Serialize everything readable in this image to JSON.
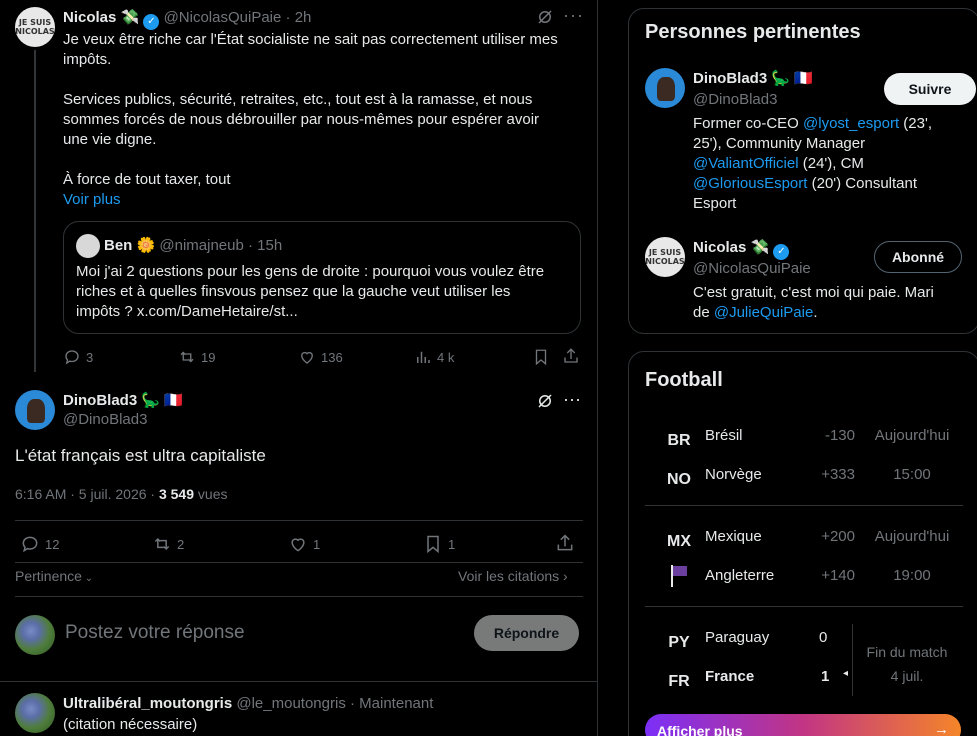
{
  "quoted_tweet": {
    "author_name": "Nicolas",
    "author_emoji": "💸",
    "handle": "@NicolasQuiPaie",
    "time": "2h",
    "text_1": "Je veux être riche car l'État socialiste ne sait pas correctement utiliser mes",
    "text_2": "impôts.",
    "text_3": "Services publics, sécurité, retraites, etc., tout est à la ramasse, et nous",
    "text_4": "sommes forcés de nous débrouiller par nous-mêmes pour espérer avoir",
    "text_5": "une vie digne.",
    "text_6": "À force de tout taxer, tout",
    "see_more": "Voir plus",
    "avatar_text_1": "JE SUIS",
    "avatar_text_2": "NICOLAS",
    "inner": {
      "author_name": "Ben",
      "author_emoji": "🌼",
      "handle": "@nimajneub",
      "time": "15h",
      "text_1": "Moi j'ai 2 questions pour les gens de droite : pourquoi vous voulez être",
      "text_2": "riches et à quelles finsvous pensez que la gauche veut utiliser les",
      "text_3": "impôts ? x.com/DameHetaire/st..."
    },
    "stats": {
      "replies": "3",
      "reposts": "19",
      "likes": "136",
      "views": "4 k"
    }
  },
  "main_tweet": {
    "author_name": "DinoBlad3",
    "author_emoji": "🦕",
    "flag": "🇫🇷",
    "handle": "@DinoBlad3",
    "text": "L'état français est ultra capitaliste",
    "timestamp": "6:16 AM · 5 juil. 2026 · ",
    "views_count": "3 549",
    "views_label": " vues",
    "stats": {
      "replies": "12",
      "reposts": "2",
      "likes": "1",
      "bookmarks": "1"
    },
    "sort_label": "Pertinence",
    "quotes_label": "Voir les citations"
  },
  "reply_box": {
    "placeholder": "Postez votre réponse",
    "button": "Répondre"
  },
  "reply_tweet": {
    "author_name": "Ultralibéral_moutongris",
    "handle": "@le_moutongris",
    "time": "Maintenant",
    "text": "(citation nécessaire)"
  },
  "relevant_people": {
    "title": "Personnes pertinentes",
    "people": [
      {
        "name": "DinoBlad3",
        "emoji": "🦕",
        "flag": "🇫🇷",
        "handle": "@DinoBlad3",
        "button": "Suivre",
        "bio_1a": "Former co-CEO ",
        "bio_1b": "@lyost_esport",
        "bio_1c": " (23',",
        "bio_2": "25'), Community Manager",
        "bio_3a": "@ValiantOfficiel",
        "bio_3b": " (24'), CM",
        "bio_4a": "@GloriousEsport",
        "bio_4b": " (20') Consultant",
        "bio_5": "Esport"
      },
      {
        "name": "Nicolas",
        "emoji": "💸",
        "handle": "@NicolasQuiPaie",
        "button": "Abonné",
        "bio_1": "C'est gratuit, c'est moi qui paie. Mari",
        "bio_2a": "de ",
        "bio_2b": "@JulieQuiPaie",
        "bio_2c": "."
      }
    ]
  },
  "football": {
    "title": "Football",
    "matches": [
      {
        "team1_code": "BR",
        "team1": "Brésil",
        "odds1": "-130",
        "team2_code": "NO",
        "team2": "Norvège",
        "odds2": "+333",
        "day": "Aujourd'hui",
        "time": "15:00"
      },
      {
        "team1_code": "MX",
        "team1": "Mexique",
        "odds1": "+200",
        "team2": "Angleterre",
        "odds2": "+140",
        "day": "Aujourd'hui",
        "time": "19:00"
      },
      {
        "team1_code": "PY",
        "team1": "Paraguay",
        "score1": "0",
        "team2_code": "FR",
        "team2": "France",
        "score2": "1",
        "status": "Fin du match",
        "date": "4 juil."
      }
    ],
    "show_more": "Afficher plus"
  },
  "colors": {
    "accent": "#1d9bf0",
    "background": "#000000",
    "border": "#2f3336",
    "muted": "#71767b"
  }
}
